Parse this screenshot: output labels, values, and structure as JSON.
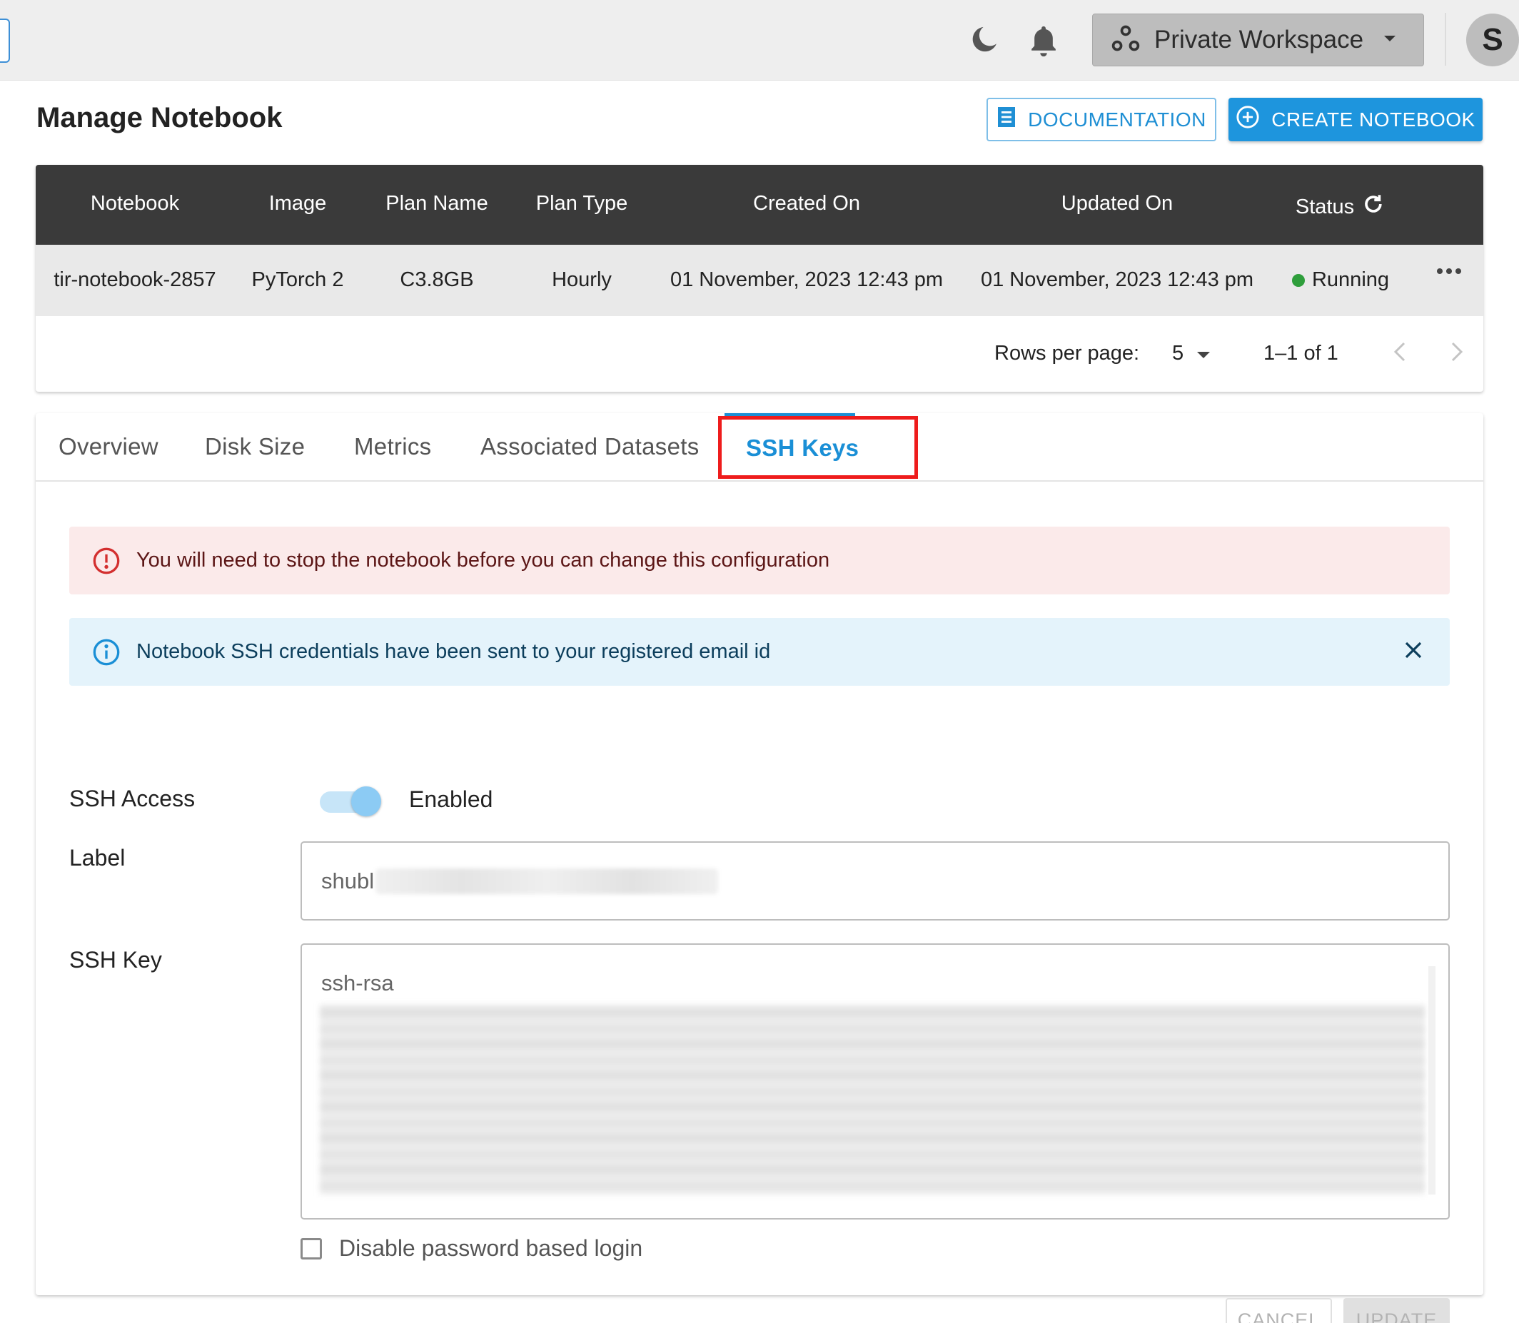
{
  "topbar": {
    "theme_icon": "moon-icon",
    "notifications_icon": "bell-icon",
    "workspace": {
      "icon": "workspace-nodes-icon",
      "label": "Private Workspace"
    },
    "avatar_letter": "S"
  },
  "header": {
    "title": "Manage Notebook",
    "documentation_label": "DOCUMENTATION",
    "create_label": "CREATE NOTEBOOK"
  },
  "table": {
    "columns": [
      "Notebook",
      "Image",
      "Plan Name",
      "Plan Type",
      "Created On",
      "Updated On",
      "Status"
    ],
    "rows": [
      {
        "notebook": "tir-notebook-2857",
        "image": "PyTorch 2",
        "plan_name": "C3.8GB",
        "plan_type": "Hourly",
        "created_on": "01 November, 2023 12:43 pm",
        "updated_on": "01 November, 2023 12:43 pm",
        "status": "Running"
      }
    ],
    "pagination": {
      "rows_per_page_label": "Rows per page:",
      "rows_per_page": "5",
      "range": "1–1 of 1"
    }
  },
  "tabs": [
    {
      "label": "Overview"
    },
    {
      "label": "Disk Size"
    },
    {
      "label": "Metrics"
    },
    {
      "label": "Associated Datasets"
    },
    {
      "label": "SSH Keys"
    }
  ],
  "active_tab": "SSH Keys",
  "alerts": {
    "error": "You will need to stop the notebook before you can change this configuration",
    "info": "Notebook SSH credentials have been sent to your registered email id"
  },
  "ssh_form": {
    "access_label": "SSH Access",
    "access_state": "Enabled",
    "label_label": "Label",
    "label_value": "shubl",
    "key_label": "SSH Key",
    "key_value": "ssh-rsa",
    "disable_password_label": "Disable password based login",
    "cancel_label": "CANCEL",
    "update_label": "UPDATE"
  },
  "colors": {
    "primary": "#1e95dd",
    "header_bg": "#3a3a3a",
    "running": "#2e9e3b",
    "error_bg": "#fbeaea",
    "info_bg": "#e4f3fb",
    "highlight": "#ee1c1c"
  }
}
